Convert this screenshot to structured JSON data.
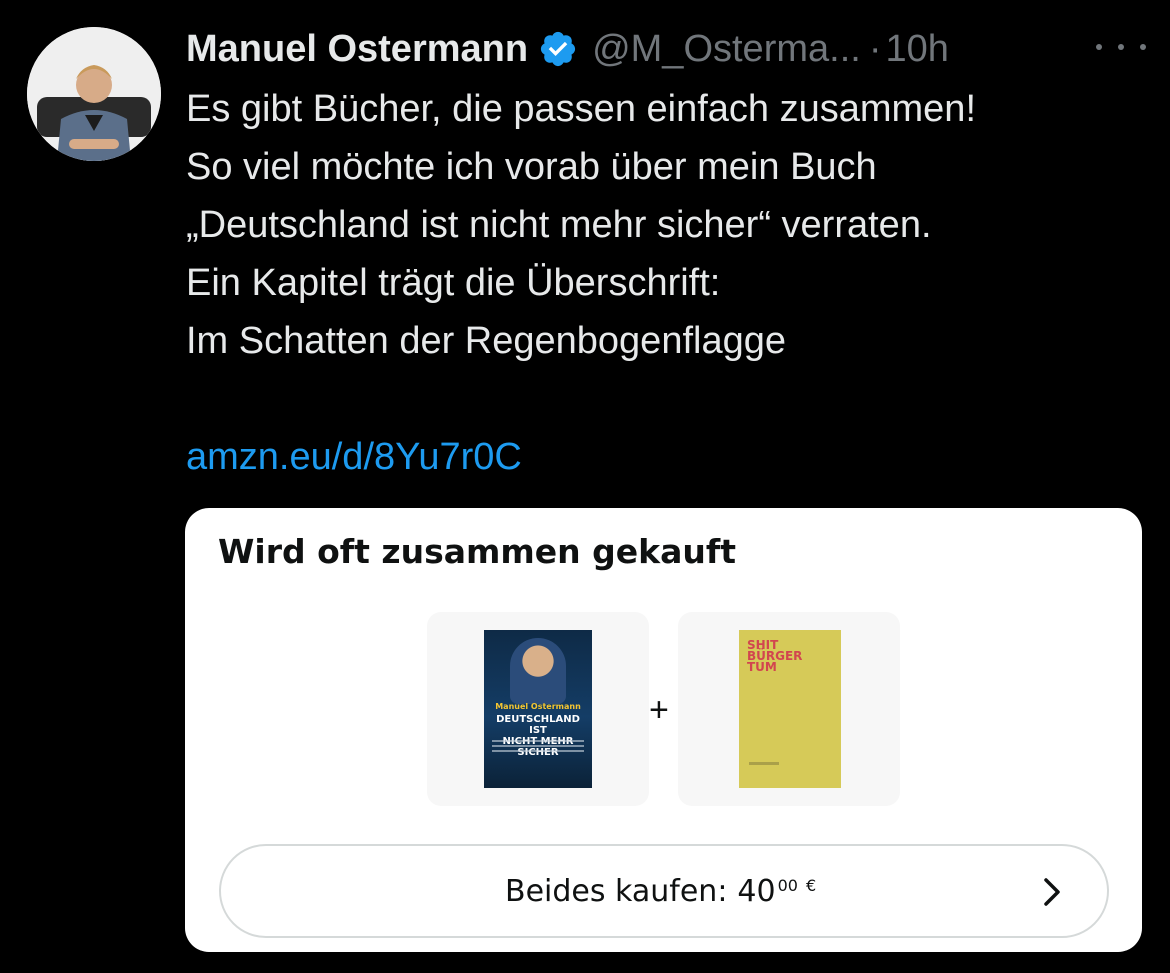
{
  "author": {
    "name": "Manuel Ostermann",
    "handle": "@M_Osterma...",
    "separator": "·",
    "time": "10h"
  },
  "tweet": {
    "lines": [
      "Es gibt Bücher, die passen einfach zusammen!",
      "So viel möchte ich vorab über mein Buch",
      "„Deutschland ist nicht mehr sicher“ verraten.",
      "Ein Kapitel trägt die Überschrift:",
      "Im Schatten der Regenbogenflagge"
    ],
    "link": "amzn.eu/d/8Yu7r0C"
  },
  "card": {
    "title": "Wird oft zusammen gekauft",
    "plus": "+",
    "book1": {
      "author": "Manuel Ostermann",
      "title_line1": "DEUTSCHLAND IST",
      "title_line2": "NICHT MEHR SICHER"
    },
    "book2": {
      "title_lines": [
        "SHIT",
        "BÜRGER",
        "TUM"
      ]
    },
    "buy": {
      "label": "Beides kaufen:",
      "price_whole": "40",
      "price_cents": "00",
      "currency": "€"
    }
  },
  "icons": {
    "verified": "verified-badge-icon",
    "more": "more-options-icon",
    "chevron": "chevron-right-icon"
  },
  "colors": {
    "background": "#000000",
    "text": "#e7e9ea",
    "muted": "#71767b",
    "link": "#1d9bf0",
    "verified": "#1d9bf0"
  }
}
